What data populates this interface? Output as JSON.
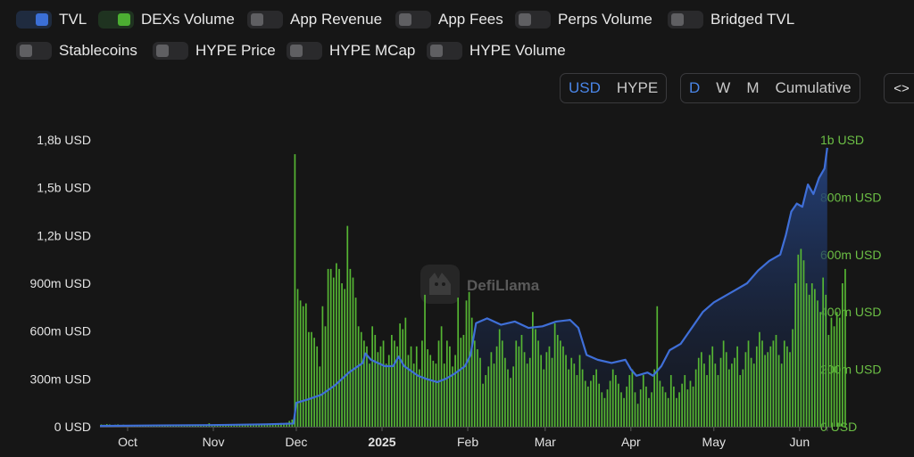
{
  "legend": {
    "items": [
      {
        "key": "tvl",
        "label": "TVL",
        "on": true,
        "color": "#3b6fd6"
      },
      {
        "key": "dex",
        "label": "DEXs Volume",
        "on": true,
        "color": "#4caf32"
      },
      {
        "key": "app_revenue",
        "label": "App Revenue",
        "on": false
      },
      {
        "key": "app_fees",
        "label": "App Fees",
        "on": false
      },
      {
        "key": "perps",
        "label": "Perps Volume",
        "on": false
      },
      {
        "key": "bridged",
        "label": "Bridged TVL",
        "on": false
      },
      {
        "key": "stablecoins",
        "label": "Stablecoins",
        "on": false
      },
      {
        "key": "hype_price",
        "label": "HYPE Price",
        "on": false
      },
      {
        "key": "hype_mcap",
        "label": "HYPE MCap",
        "on": false
      },
      {
        "key": "hype_volume",
        "label": "HYPE Volume",
        "on": false
      }
    ]
  },
  "controls": {
    "denomination": [
      {
        "label": "USD",
        "active": true
      },
      {
        "label": "HYPE",
        "active": false
      }
    ],
    "period": [
      {
        "label": "D",
        "active": true
      },
      {
        "label": "W",
        "active": false
      },
      {
        "label": "M",
        "active": false
      },
      {
        "label": "Cumulative",
        "active": false
      }
    ],
    "embed_label": "<>"
  },
  "watermark": {
    "text": "DefiLlama"
  },
  "chart_data": {
    "type": "bar",
    "left_axis": {
      "ticks": [
        "0 USD",
        "300m USD",
        "600m USD",
        "900m USD",
        "1,2b USD",
        "1,5b USD",
        "1,8b USD"
      ],
      "ylim": [
        0,
        1800000000
      ]
    },
    "right_axis": {
      "ticks": [
        "0 USD",
        "200m USD",
        "400m USD",
        "600m USD",
        "800m USD",
        "1b USD"
      ],
      "ylim": [
        0,
        1000000000
      ]
    },
    "x_ticks": [
      {
        "label": "Oct",
        "bold": false,
        "day": 10
      },
      {
        "label": "Nov",
        "bold": false,
        "day": 41
      },
      {
        "label": "Dec",
        "bold": false,
        "day": 71
      },
      {
        "label": "2025",
        "bold": true,
        "day": 102
      },
      {
        "label": "Feb",
        "bold": false,
        "day": 133
      },
      {
        "label": "Mar",
        "bold": false,
        "day": 161
      },
      {
        "label": "Apr",
        "bold": false,
        "day": 192
      },
      {
        "label": "May",
        "bold": false,
        "day": 222
      },
      {
        "label": "Jun",
        "bold": false,
        "day": 253
      },
      {
        "label": "",
        "bold": false,
        "day": 263
      }
    ],
    "colors": {
      "tvl_line": "#3f6fd8",
      "tvl_fill_top": "#243c72",
      "dex_bar": "#55b533",
      "grid": "#2c2c2c"
    },
    "tvl_series": {
      "name": "TVL",
      "axis": "left",
      "points": [
        [
          0,
          0.005
        ],
        [
          20,
          0.008
        ],
        [
          40,
          0.01
        ],
        [
          60,
          0.015
        ],
        [
          70,
          0.02
        ],
        [
          71,
          0.15
        ],
        [
          75,
          0.17
        ],
        [
          80,
          0.2
        ],
        [
          85,
          0.26
        ],
        [
          90,
          0.34
        ],
        [
          95,
          0.4
        ],
        [
          96,
          0.46
        ],
        [
          98,
          0.42
        ],
        [
          103,
          0.38
        ],
        [
          106,
          0.38
        ],
        [
          108,
          0.44
        ],
        [
          110,
          0.38
        ],
        [
          115,
          0.32
        ],
        [
          118,
          0.3
        ],
        [
          122,
          0.28
        ],
        [
          125,
          0.3
        ],
        [
          128,
          0.33
        ],
        [
          132,
          0.38
        ],
        [
          134,
          0.45
        ],
        [
          136,
          0.65
        ],
        [
          140,
          0.68
        ],
        [
          145,
          0.64
        ],
        [
          150,
          0.66
        ],
        [
          155,
          0.62
        ],
        [
          160,
          0.63
        ],
        [
          165,
          0.66
        ],
        [
          170,
          0.67
        ],
        [
          173,
          0.62
        ],
        [
          176,
          0.45
        ],
        [
          180,
          0.42
        ],
        [
          185,
          0.4
        ],
        [
          190,
          0.42
        ],
        [
          192,
          0.36
        ],
        [
          194,
          0.32
        ],
        [
          198,
          0.34
        ],
        [
          200,
          0.32
        ],
        [
          203,
          0.38
        ],
        [
          206,
          0.48
        ],
        [
          210,
          0.52
        ],
        [
          214,
          0.62
        ],
        [
          218,
          0.72
        ],
        [
          222,
          0.78
        ],
        [
          226,
          0.82
        ],
        [
          230,
          0.86
        ],
        [
          234,
          0.9
        ],
        [
          238,
          0.98
        ],
        [
          242,
          1.04
        ],
        [
          246,
          1.08
        ],
        [
          248,
          1.2
        ],
        [
          250,
          1.35
        ],
        [
          252,
          1.4
        ],
        [
          254,
          1.38
        ],
        [
          256,
          1.52
        ],
        [
          258,
          1.46
        ],
        [
          260,
          1.56
        ],
        [
          262,
          1.62
        ],
        [
          263,
          1.75
        ]
      ]
    },
    "dex_series": {
      "name": "DEXs Volume",
      "axis": "right",
      "values": [
        0.008,
        0.007,
        0.009,
        0.008,
        0.006,
        0.007,
        0.008,
        0.006,
        0.007,
        0.005,
        0.006,
        0.005,
        0.004,
        0.005,
        0.004,
        0.005,
        0.004,
        0.004,
        0.003,
        0.004,
        0.004,
        0.003,
        0.003,
        0.004,
        0.003,
        0.003,
        0.004,
        0.003,
        0.004,
        0.003,
        0.003,
        0.004,
        0.003,
        0.004,
        0.003,
        0.004,
        0.005,
        0.004,
        0.003,
        0.012,
        0.006,
        0.005,
        0.006,
        0.004,
        0.005,
        0.006,
        0.005,
        0.007,
        0.006,
        0.006,
        0.007,
        0.006,
        0.007,
        0.007,
        0.008,
        0.007,
        0.008,
        0.008,
        0.009,
        0.009,
        0.01,
        0.011,
        0.01,
        0.012,
        0.012,
        0.013,
        0.012,
        0.014,
        0.02,
        0.025,
        0.95,
        0.48,
        0.44,
        0.42,
        0.43,
        0.33,
        0.33,
        0.31,
        0.28,
        0.21,
        0.42,
        0.35,
        0.55,
        0.55,
        0.52,
        0.57,
        0.55,
        0.5,
        0.48,
        0.7,
        0.55,
        0.52,
        0.45,
        0.35,
        0.33,
        0.3,
        0.28,
        0.22,
        0.35,
        0.32,
        0.26,
        0.28,
        0.3,
        0.22,
        0.25,
        0.32,
        0.3,
        0.28,
        0.36,
        0.34,
        0.38,
        0.25,
        0.28,
        0.22,
        0.28,
        0.2,
        0.3,
        0.46,
        0.27,
        0.25,
        0.23,
        0.22,
        0.3,
        0.35,
        0.22,
        0.3,
        0.28,
        0.21,
        0.25,
        0.45,
        0.31,
        0.32,
        0.44,
        0.47,
        0.38,
        0.3,
        0.27,
        0.24,
        0.15,
        0.18,
        0.21,
        0.26,
        0.22,
        0.28,
        0.34,
        0.3,
        0.24,
        0.2,
        0.17,
        0.21,
        0.3,
        0.28,
        0.32,
        0.26,
        0.22,
        0.24,
        0.4,
        0.34,
        0.3,
        0.25,
        0.2,
        0.26,
        0.28,
        0.24,
        0.36,
        0.32,
        0.3,
        0.28,
        0.25,
        0.2,
        0.24,
        0.22,
        0.18,
        0.25,
        0.2,
        0.16,
        0.14,
        0.16,
        0.18,
        0.2,
        0.15,
        0.12,
        0.1,
        0.13,
        0.16,
        0.2,
        0.18,
        0.15,
        0.12,
        0.1,
        0.14,
        0.18,
        0.2,
        0.12,
        0.08,
        0.13,
        0.18,
        0.14,
        0.1,
        0.12,
        0.2,
        0.42,
        0.16,
        0.14,
        0.12,
        0.1,
        0.18,
        0.14,
        0.1,
        0.12,
        0.15,
        0.18,
        0.13,
        0.16,
        0.14,
        0.2,
        0.24,
        0.26,
        0.22,
        0.18,
        0.25,
        0.28,
        0.22,
        0.18,
        0.24,
        0.3,
        0.26,
        0.2,
        0.22,
        0.24,
        0.28,
        0.18,
        0.2,
        0.26,
        0.3,
        0.24,
        0.22,
        0.28,
        0.33,
        0.3,
        0.25,
        0.26,
        0.28,
        0.3,
        0.32,
        0.25,
        0.22,
        0.3,
        0.28,
        0.26,
        0.34,
        0.5,
        0.6,
        0.62,
        0.58,
        0.5,
        0.46,
        0.5,
        0.48,
        0.44,
        0.4,
        0.52,
        0.46,
        0.32,
        0.38,
        0.35,
        0.4,
        0.38,
        0.5,
        0.55
      ]
    }
  }
}
